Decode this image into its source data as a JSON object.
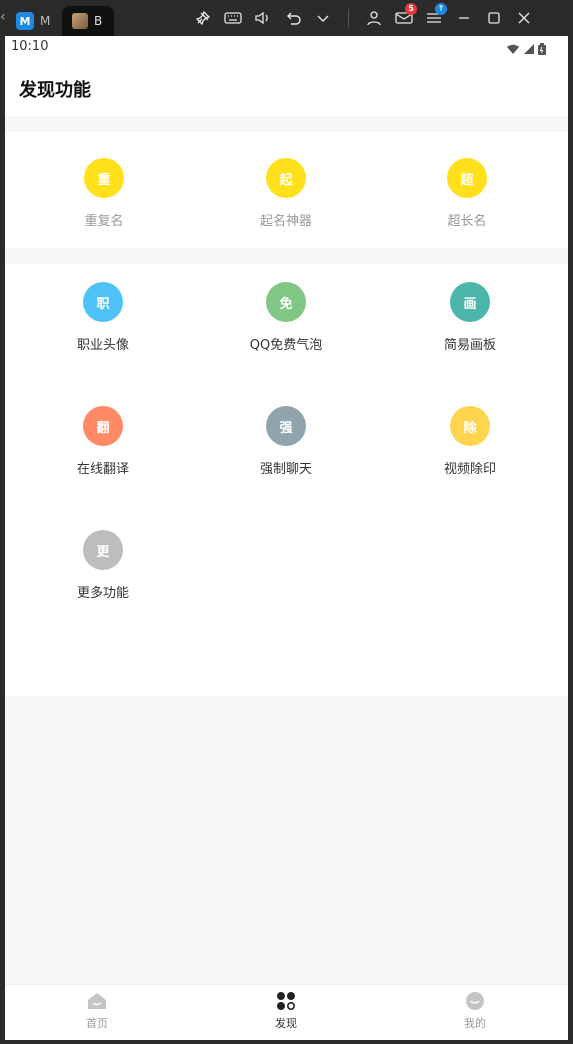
{
  "desktop": {
    "tabs": [
      {
        "label": "M"
      },
      {
        "label": "B"
      }
    ],
    "mail_badge": "5"
  },
  "status": {
    "time": "10:10"
  },
  "header": {
    "title": "发现功能"
  },
  "colors": {
    "yellow": "#FFE01A",
    "blue": "#4FC3F7",
    "green": "#81C784",
    "teal": "#4DB6AC",
    "orange": "#FF8A65",
    "slate": "#90A4AE",
    "amber": "#FFD54F",
    "grey": "#BDBDBD"
  },
  "section1": [
    {
      "glyph": "重",
      "label": "重复名"
    },
    {
      "glyph": "起",
      "label": "起名神器"
    },
    {
      "glyph": "超",
      "label": "超长名"
    }
  ],
  "section2": [
    {
      "glyph": "职",
      "label": "职业头像"
    },
    {
      "glyph": "免",
      "label": "QQ免费气泡"
    },
    {
      "glyph": "画",
      "label": "简易画板"
    },
    {
      "glyph": "翻",
      "label": "在线翻译"
    },
    {
      "glyph": "强",
      "label": "强制聊天"
    },
    {
      "glyph": "除",
      "label": "视频除印"
    },
    {
      "glyph": "更",
      "label": "更多功能"
    }
  ],
  "nav": [
    {
      "label": "首页",
      "icon": "home-icon"
    },
    {
      "label": "发现",
      "icon": "discover-grid-icon"
    },
    {
      "label": "我的",
      "icon": "profile-icon"
    }
  ]
}
